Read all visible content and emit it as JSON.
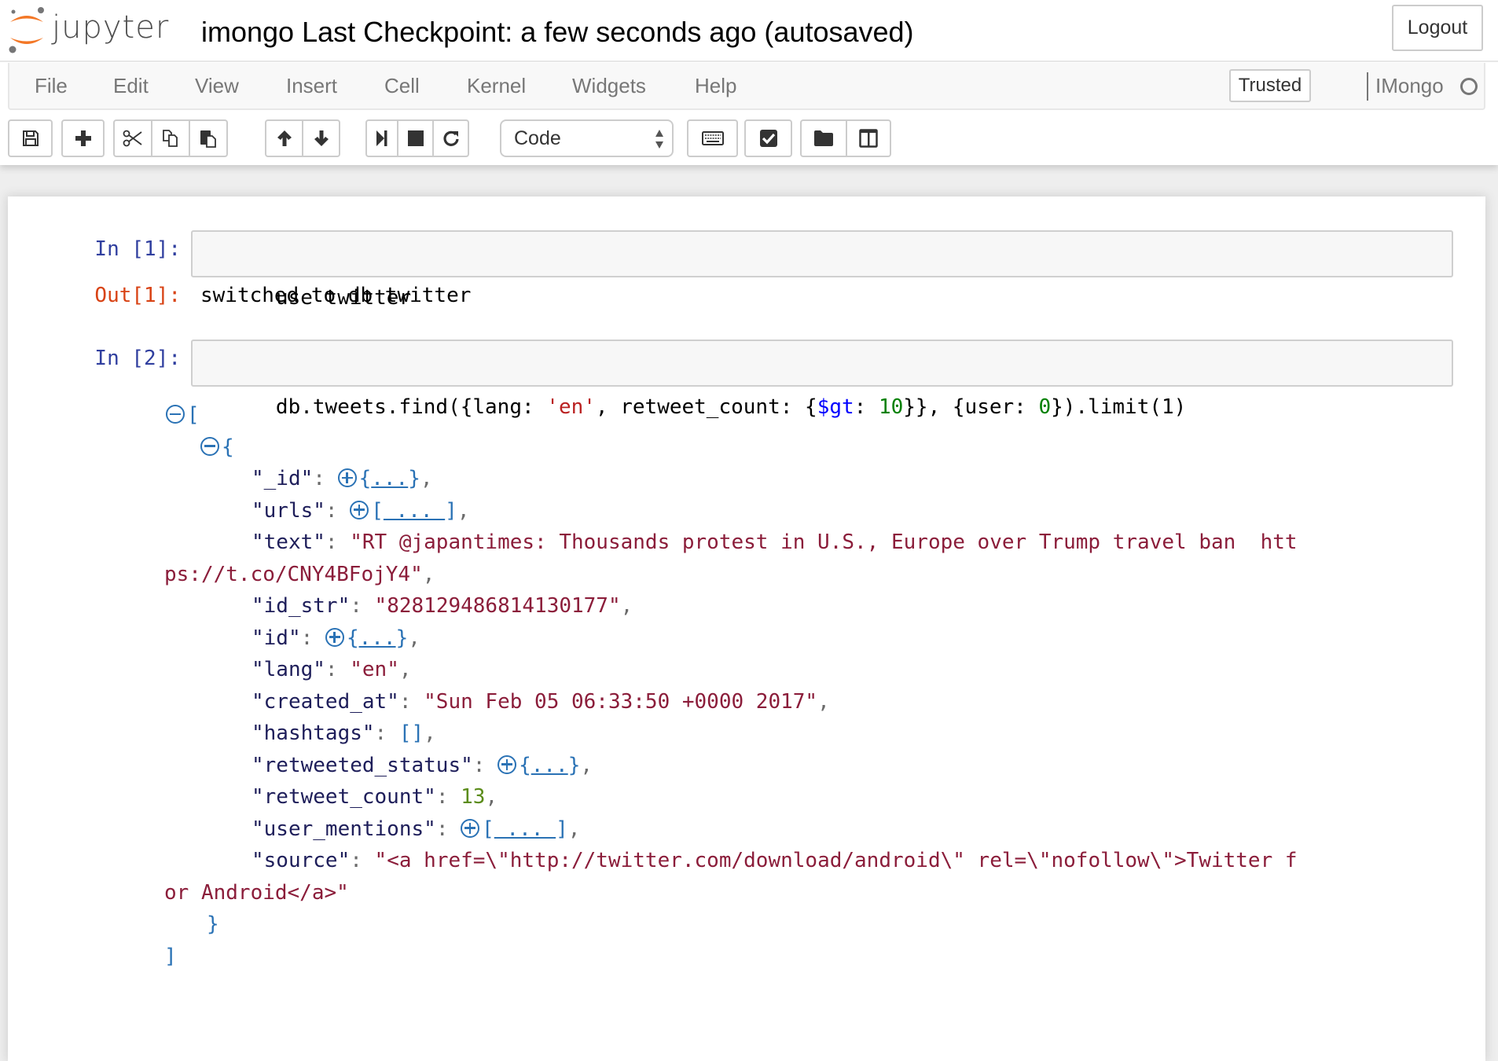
{
  "header": {
    "logo_text": "jupyter",
    "notebook_name": "imongo",
    "checkpoint": "Last Checkpoint: a few seconds ago (autosaved)",
    "logout_label": "Logout"
  },
  "menubar": {
    "items": [
      "File",
      "Edit",
      "View",
      "Insert",
      "Cell",
      "Kernel",
      "Widgets",
      "Help"
    ],
    "trusted_label": "Trusted",
    "kernel_name": "IMongo",
    "kernel_status": "idle"
  },
  "toolbar": {
    "buttons": [
      {
        "icon": "save-icon",
        "title": "Save and Checkpoint"
      },
      {
        "icon": "plus-icon",
        "title": "Insert cell below"
      },
      {
        "icon": "cut-icon",
        "title": "Cut selected cells"
      },
      {
        "icon": "copy-icon",
        "title": "Copy selected cells"
      },
      {
        "icon": "paste-icon",
        "title": "Paste cells below"
      },
      {
        "icon": "arrow-up-icon",
        "title": "Move selected cells up"
      },
      {
        "icon": "arrow-down-icon",
        "title": "Move selected cells down"
      },
      {
        "icon": "step-forward-icon",
        "title": "Run"
      },
      {
        "icon": "stop-icon",
        "title": "Interrupt kernel"
      },
      {
        "icon": "restart-icon",
        "title": "Restart kernel"
      },
      {
        "icon": "keyboard-icon",
        "title": "Command palette"
      },
      {
        "icon": "checkbox-icon",
        "title": "Toggle"
      },
      {
        "icon": "folder-icon",
        "title": "Open"
      },
      {
        "icon": "columns-icon",
        "title": "Split"
      }
    ],
    "cell_type": "Code"
  },
  "cells": [
    {
      "in_prompt": "In [1]:",
      "source": "use twitter",
      "out_prompt": "Out[1]:",
      "output": "switched to db twitter"
    },
    {
      "in_prompt": "In [2]:",
      "source_tokens": [
        {
          "t": "db.tweets.find({lang: ",
          "c": ""
        },
        {
          "t": "'en'",
          "c": "str"
        },
        {
          "t": ", retweet_count: {",
          "c": ""
        },
        {
          "t": "$gt",
          "c": "var"
        },
        {
          "t": ": ",
          "c": ""
        },
        {
          "t": "10",
          "c": "num"
        },
        {
          "t": "}}, {user: ",
          "c": ""
        },
        {
          "t": "0",
          "c": "num"
        },
        {
          "t": "}).limit(1)",
          "c": ""
        }
      ],
      "output_tree": {
        "open_bracket": "[",
        "open_brace": "{",
        "fields": [
          {
            "key": "\"_id\"",
            "type": "collapsed-object",
            "preview": "{...}"
          },
          {
            "key": "\"urls\"",
            "type": "collapsed-array",
            "preview": "[ ... ]"
          },
          {
            "key": "\"text\"",
            "type": "string",
            "value": "\"RT @japantimes: Thousands protest in U.S., Europe over Trump travel ban  htt",
            "value_cont": "ps://t.co/CNY4BFojY4\""
          },
          {
            "key": "\"id_str\"",
            "type": "string",
            "value": "\"828129486814130177\""
          },
          {
            "key": "\"id\"",
            "type": "collapsed-object",
            "preview": "{...}"
          },
          {
            "key": "\"lang\"",
            "type": "string",
            "value": "\"en\""
          },
          {
            "key": "\"created_at\"",
            "type": "string",
            "value": "\"Sun Feb 05 06:33:50 +0000 2017\""
          },
          {
            "key": "\"hashtags\"",
            "type": "empty-array",
            "value": "[]"
          },
          {
            "key": "\"retweeted_status\"",
            "type": "collapsed-object",
            "preview": "{...}"
          },
          {
            "key": "\"retweet_count\"",
            "type": "number",
            "value": "13"
          },
          {
            "key": "\"user_mentions\"",
            "type": "collapsed-array",
            "preview": "[ ... ]"
          },
          {
            "key": "\"source\"",
            "type": "string",
            "value": "\"<a href=\\\"http://twitter.com/download/android\\\" rel=\\\"nofollow\\\">Twitter f",
            "value_cont": "or Android</a>\"",
            "last": true
          }
        ],
        "close_brace": "}",
        "close_bracket": "]"
      }
    }
  ],
  "colors": {
    "in_prompt": "#303f9f",
    "out_prompt": "#d84315",
    "json_key": "#1e1e5a",
    "json_string": "#8b1d3a",
    "json_number": "#5b8c1a",
    "json_toggle": "#2a72b5"
  }
}
